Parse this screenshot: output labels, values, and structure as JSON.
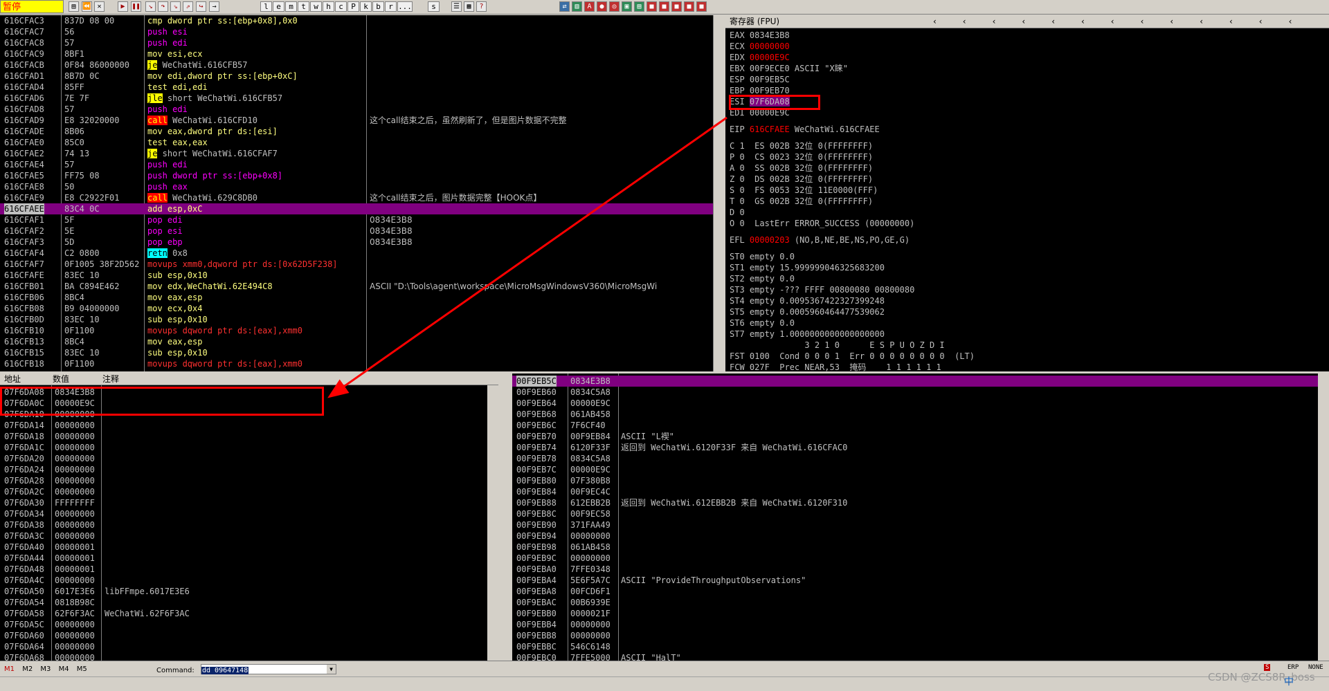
{
  "toolbar": {
    "status": "暂停",
    "letters": [
      "l",
      "e",
      "m",
      "t",
      "w",
      "h",
      "c",
      "P",
      "k",
      "b",
      "r",
      "...",
      "s"
    ]
  },
  "cpu": {
    "rows": [
      {
        "addr": "616CFAC3",
        "hex": "837D 08 00",
        "asm": "cmp dword ptr ss:[ebp+0x8],0x0",
        "comment": ""
      },
      {
        "addr": "616CFAC7",
        "hex": "56",
        "asm": "push esi",
        "comment": ""
      },
      {
        "addr": "616CFAC8",
        "hex": "57",
        "asm": "push edi",
        "comment": ""
      },
      {
        "addr": "616CFAC9",
        "hex": "8BF1",
        "asm": "mov esi,ecx",
        "comment": ""
      },
      {
        "addr": "616CFACB",
        "hex": "0F84 86000000",
        "asm": "je WeChatWi.616CFB57",
        "comment": ""
      },
      {
        "addr": "616CFAD1",
        "hex": "8B7D 0C",
        "asm": "mov edi,dword ptr ss:[ebp+0xC]",
        "comment": ""
      },
      {
        "addr": "616CFAD4",
        "hex": "85FF",
        "asm": "test edi,edi",
        "comment": ""
      },
      {
        "addr": "616CFAD6",
        "hex": "7E 7F",
        "asm": "jle short WeChatWi.616CFB57",
        "comment": ""
      },
      {
        "addr": "616CFAD8",
        "hex": "57",
        "asm": "push edi",
        "comment": ""
      },
      {
        "addr": "616CFAD9",
        "hex": "E8 32020000",
        "asm": "call WeChatWi.616CFD10",
        "comment": "这个call结束之后，虽然刷新了，但是图片数据不完整"
      },
      {
        "addr": "616CFADE",
        "hex": "8B06",
        "asm": "mov eax,dword ptr ds:[esi]",
        "comment": ""
      },
      {
        "addr": "616CFAE0",
        "hex": "85C0",
        "asm": "test eax,eax",
        "comment": ""
      },
      {
        "addr": "616CFAE2",
        "hex": "74 13",
        "asm": "je short WeChatWi.616CFAF7",
        "comment": ""
      },
      {
        "addr": "616CFAE4",
        "hex": "57",
        "asm": "push edi",
        "comment": ""
      },
      {
        "addr": "616CFAE5",
        "hex": "FF75 08",
        "asm": "push dword ptr ss:[ebp+0x8]",
        "comment": ""
      },
      {
        "addr": "616CFAE8",
        "hex": "50",
        "asm": "push eax",
        "comment": ""
      },
      {
        "addr": "616CFAE9",
        "hex": "E8 C2922F01",
        "asm": "call WeChatWi.629C8DB0",
        "comment": "这个call结束之后，图片数据完整【HOOK点】"
      },
      {
        "addr": "616CFAEE",
        "hex": "83C4 0C",
        "asm": "add esp,0xC",
        "comment": ""
      },
      {
        "addr": "616CFAF1",
        "hex": "5F",
        "asm": "pop edi",
        "comment": "0834E3B8"
      },
      {
        "addr": "616CFAF2",
        "hex": "5E",
        "asm": "pop esi",
        "comment": "0834E3B8"
      },
      {
        "addr": "616CFAF3",
        "hex": "5D",
        "asm": "pop ebp",
        "comment": "0834E3B8"
      },
      {
        "addr": "616CFAF4",
        "hex": "C2 0800",
        "asm": "retn 0x8",
        "comment": ""
      },
      {
        "addr": "616CFAF7",
        "hex": "0F1005 38F2D562",
        "asm": "movups xmm0,dqword ptr ds:[0x62D5F238]",
        "comment": ""
      },
      {
        "addr": "616CFAFE",
        "hex": "83EC 10",
        "asm": "sub esp,0x10",
        "comment": ""
      },
      {
        "addr": "616CFB01",
        "hex": "BA C894E462",
        "asm": "mov edx,WeChatWi.62E494C8",
        "comment": "ASCII \"D:\\Tools\\agent\\workspace\\MicroMsgWindowsV360\\MicroMsgWi"
      },
      {
        "addr": "616CFB06",
        "hex": "8BC4",
        "asm": "mov eax,esp",
        "comment": ""
      },
      {
        "addr": "616CFB08",
        "hex": "B9 04000000",
        "asm": "mov ecx,0x4",
        "comment": ""
      },
      {
        "addr": "616CFB0D",
        "hex": "83EC 10",
        "asm": "sub esp,0x10",
        "comment": ""
      },
      {
        "addr": "616CFB10",
        "hex": "0F1100",
        "asm": "movups dqword ptr ds:[eax],xmm0",
        "comment": ""
      },
      {
        "addr": "616CFB13",
        "hex": "8BC4",
        "asm": "mov eax,esp",
        "comment": ""
      },
      {
        "addr": "616CFB15",
        "hex": "83EC 10",
        "asm": "sub esp,0x10",
        "comment": ""
      },
      {
        "addr": "616CFB18",
        "hex": "0F1100",
        "asm": "movups dqword ptr ds:[eax],xmm0",
        "comment": ""
      }
    ]
  },
  "registers": {
    "title": "寄存器 (FPU)",
    "lines": [
      "EAX 0834E3B8",
      "ECX 00000000",
      "EDX 00000E9C",
      "EBX 00F9ECE0 ASCII \"X睐\"",
      "ESP 00F9EB5C",
      "EBP 00F9EB70",
      "ESI 07F6DA08",
      "EDI 00000E9C",
      "",
      "EIP 616CFAEE WeChatWi.616CFAEE",
      "",
      "C 1  ES 002B 32位 0(FFFFFFFF)",
      "P 0  CS 0023 32位 0(FFFFFFFF)",
      "A 0  SS 002B 32位 0(FFFFFFFF)",
      "Z 0  DS 002B 32位 0(FFFFFFFF)",
      "S 0  FS 0053 32位 11E0000(FFF)",
      "T 0  GS 002B 32位 0(FFFFFFFF)",
      "D 0",
      "O 0  LastErr ERROR_SUCCESS (00000000)",
      "",
      "EFL 00000203 (NO,B,NE,BE,NS,PO,GE,G)",
      "",
      "ST0 empty 0.0",
      "ST1 empty 15.999999046325683200",
      "ST2 empty 0.0",
      "ST3 empty -??? FFFF 00800080 00800080",
      "ST4 empty 0.0095367422327399248",
      "ST5 empty 0.0005960464477539062",
      "ST6 empty 0.0",
      "ST7 empty 1.0000000000000000000",
      "               3 2 1 0      E S P U O Z D I",
      "FST 0100  Cond 0 0 0 1  Err 0 0 0 0 0 0 0 0  (LT)",
      "FCW 027F  Prec NEAR,53  掩码    1 1 1 1 1 1"
    ]
  },
  "dump": {
    "headers": [
      "地址",
      "数值",
      "注释"
    ],
    "rows": [
      [
        "07F6DA08",
        "0834E3B8",
        ""
      ],
      [
        "07F6DA0C",
        "00000E9C",
        ""
      ],
      [
        "07F6DA10",
        "00000000",
        ""
      ],
      [
        "07F6DA14",
        "00000000",
        ""
      ],
      [
        "07F6DA18",
        "00000000",
        ""
      ],
      [
        "07F6DA1C",
        "00000000",
        ""
      ],
      [
        "07F6DA20",
        "00000000",
        ""
      ],
      [
        "07F6DA24",
        "00000000",
        ""
      ],
      [
        "07F6DA28",
        "00000000",
        ""
      ],
      [
        "07F6DA2C",
        "00000000",
        ""
      ],
      [
        "07F6DA30",
        "FFFFFFFF",
        ""
      ],
      [
        "07F6DA34",
        "00000000",
        ""
      ],
      [
        "07F6DA38",
        "00000000",
        ""
      ],
      [
        "07F6DA3C",
        "00000000",
        ""
      ],
      [
        "07F6DA40",
        "00000001",
        ""
      ],
      [
        "07F6DA44",
        "00000001",
        ""
      ],
      [
        "07F6DA48",
        "00000001",
        ""
      ],
      [
        "07F6DA4C",
        "00000000",
        ""
      ],
      [
        "07F6DA50",
        "6017E3E6",
        "libFFmpe.6017E3E6"
      ],
      [
        "07F6DA54",
        "0818B98C",
        ""
      ],
      [
        "07F6DA58",
        "62F6F3AC",
        "WeChatWi.62F6F3AC"
      ],
      [
        "07F6DA5C",
        "00000000",
        ""
      ],
      [
        "07F6DA60",
        "00000000",
        ""
      ],
      [
        "07F6DA64",
        "00000000",
        ""
      ],
      [
        "07F6DA68",
        "00000000",
        ""
      ]
    ]
  },
  "stack": {
    "rows": [
      [
        "00F9EB5C",
        "0834E3B8",
        ""
      ],
      [
        "00F9EB60",
        "0834C5A8",
        ""
      ],
      [
        "00F9EB64",
        "00000E9C",
        ""
      ],
      [
        "00F9EB68",
        "061AB458",
        ""
      ],
      [
        "00F9EB6C",
        "7F6CF40",
        ""
      ],
      [
        "00F9EB70",
        "00F9EB84",
        "ASCII \"L褉\""
      ],
      [
        "00F9EB74",
        "6120F33F",
        "返回到 WeChatWi.6120F33F 来自 WeChatWi.616CFAC0"
      ],
      [
        "00F9EB78",
        "0834C5A8",
        ""
      ],
      [
        "00F9EB7C",
        "00000E9C",
        ""
      ],
      [
        "00F9EB80",
        "07F380B8",
        ""
      ],
      [
        "00F9EB84",
        "00F9EC4C",
        ""
      ],
      [
        "00F9EB88",
        "612EBB2B",
        "返回到 WeChatWi.612EBB2B 来自 WeChatWi.6120F310"
      ],
      [
        "00F9EB8C",
        "00F9EC58",
        ""
      ],
      [
        "00F9EB90",
        "371FAA49",
        ""
      ],
      [
        "00F9EB94",
        "00000000",
        ""
      ],
      [
        "00F9EB98",
        "061AB458",
        ""
      ],
      [
        "00F9EB9C",
        "00000000",
        ""
      ],
      [
        "00F9EBA0",
        "7FFE0348",
        ""
      ],
      [
        "00F9EBA4",
        "5E6F5A7C",
        "ASCII \"ProvideThroughputObservations\""
      ],
      [
        "00F9EBA8",
        "00FCD6F1",
        ""
      ],
      [
        "00F9EBAC",
        "00B6939E",
        ""
      ],
      [
        "00F9EBB0",
        "0000021F",
        ""
      ],
      [
        "00F9EBB4",
        "00000000",
        ""
      ],
      [
        "00F9EBB8",
        "00000000",
        ""
      ],
      [
        "00F9EBBC",
        "546C6148",
        ""
      ],
      [
        "00F9EBC0",
        "7FFE5000",
        "ASCII \"HalT\""
      ]
    ]
  },
  "bottom": {
    "tabs": [
      "M1",
      "M2",
      "M3",
      "M4",
      "M5"
    ],
    "command_label": "Command:",
    "command_value": "dd 09647148",
    "watermark": "CSDN @ZCS8R_boss",
    "right_tabs": [
      "ERP",
      "NONE"
    ],
    "ime": "中"
  }
}
